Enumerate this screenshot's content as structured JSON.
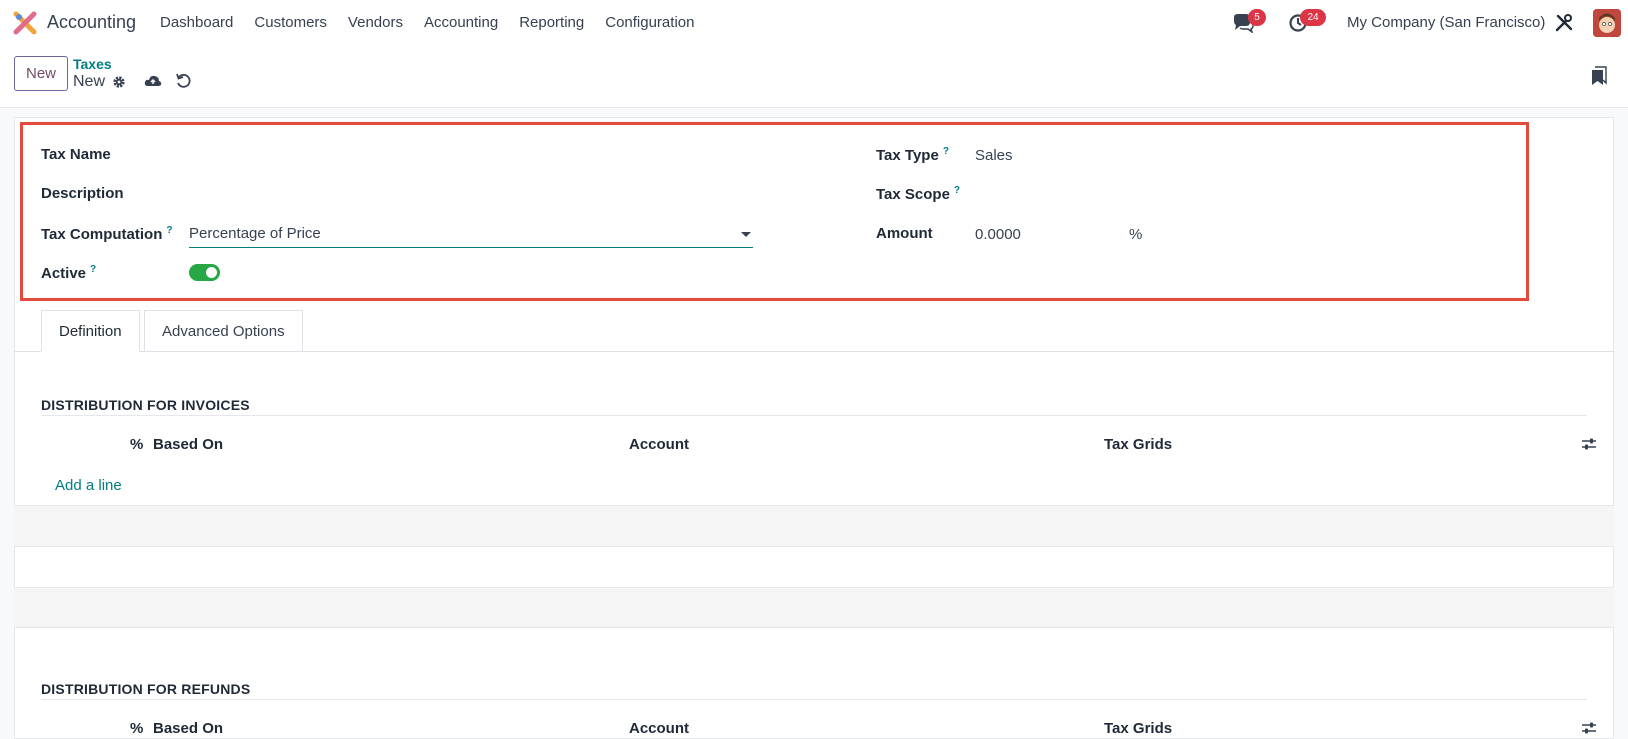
{
  "app": {
    "name": "Accounting"
  },
  "menu": [
    "Dashboard",
    "Customers",
    "Vendors",
    "Accounting",
    "Reporting",
    "Configuration"
  ],
  "systray": {
    "messages_count": "5",
    "activities_count": "24",
    "company": "My Company (San Francisco)"
  },
  "control": {
    "new_label": "New",
    "breadcrumb_parent": "Taxes",
    "breadcrumb_current": "New"
  },
  "form": {
    "tax_name_label": "Tax Name",
    "description_label": "Description",
    "tax_computation_label": "Tax Computation",
    "tax_computation_value": "Percentage of Price",
    "active_label": "Active",
    "active_value": true,
    "tax_type_label": "Tax Type",
    "tax_type_value": "Sales",
    "tax_scope_label": "Tax Scope",
    "amount_label": "Amount",
    "amount_value": "0.0000",
    "amount_unit": "%",
    "help_mark": "?"
  },
  "tabs": [
    "Definition",
    "Advanced Options"
  ],
  "invoices": {
    "title": "DISTRIBUTION FOR INVOICES",
    "columns": {
      "pct": "%",
      "based_on": "Based On",
      "account": "Account",
      "tax_grids": "Tax Grids"
    },
    "add_line": "Add a line"
  },
  "refunds": {
    "title": "DISTRIBUTION FOR REFUNDS",
    "columns": {
      "pct": "%",
      "based_on": "Based On",
      "account": "Account",
      "tax_grids": "Tax Grids"
    }
  },
  "colors": {
    "accent": "#017e84",
    "brand": "#714b67",
    "highlight": "#e14a3d",
    "toggle_on": "#28a745",
    "badge": "#dc3545"
  }
}
